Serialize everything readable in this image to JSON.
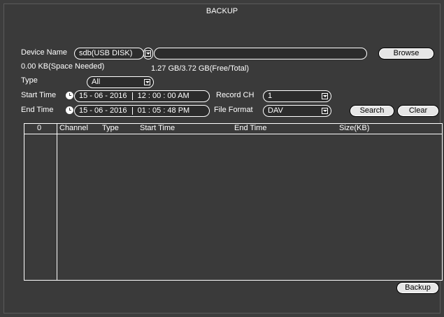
{
  "window": {
    "title": "BACKUP"
  },
  "device": {
    "label": "Device Name",
    "value": "sdb(USB DISK)",
    "path_value": "",
    "browse_label": "Browse"
  },
  "space": {
    "needed": "0.00 KB(Space Needed)",
    "free_total": "1.27 GB/3.72 GB(Free/Total)"
  },
  "type": {
    "label": "Type",
    "value": "All"
  },
  "start": {
    "label": "Start Time",
    "date": "15 - 06 -  2016",
    "time": "12 : 00 : 00 AM"
  },
  "end": {
    "label": "End Time",
    "date": "15 - 06 -  2016",
    "time": "01 : 05 : 48 PM"
  },
  "record_ch": {
    "label": "Record CH",
    "value": "1"
  },
  "file_format": {
    "label": "File Format",
    "value": "DAV"
  },
  "actions": {
    "search_label": "Search",
    "clear_label": "Clear",
    "backup_label": "Backup"
  },
  "table": {
    "columns": [
      "0",
      "Channel",
      "Type",
      "Start Time",
      "End Time",
      "Size(KB)"
    ],
    "rows": []
  },
  "icons": {
    "dropdown": "chevron-down-icon",
    "clock": "clock-icon"
  }
}
